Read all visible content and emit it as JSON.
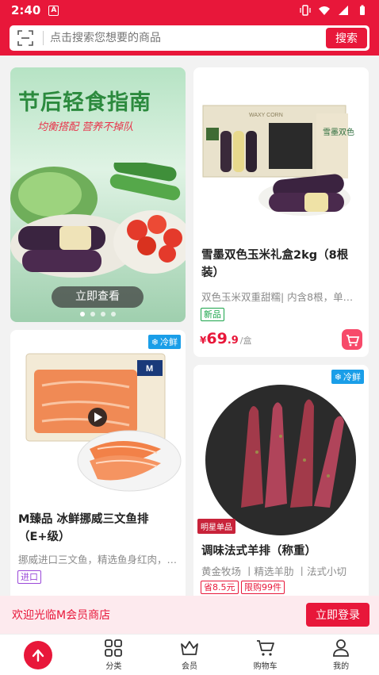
{
  "status": {
    "time": "2:40",
    "a_label": "A"
  },
  "search": {
    "placeholder": "点击搜索您想要的商品",
    "button": "搜索"
  },
  "banner": {
    "title": "节后轻食指南",
    "subtitle": "均衡搭配 营养不掉队",
    "button": "立即查看",
    "dots": 4,
    "active_dot": 0
  },
  "products": [
    {
      "name": "雪墨双色玉米礼盒2kg（8根装）",
      "desc": "双色玉米双重甜糯| 内含8根，单根…",
      "tag": "新品",
      "price_currency": "¥",
      "price_int": "69",
      "price_dec": ".9",
      "price_unit": "/盒",
      "box_text": "WAXY CORN",
      "box_side": "雪墨双色"
    },
    {
      "badge": "冷鲜",
      "name": "M臻品 冰鲜挪威三文鱼排（E+级）",
      "desc": "挪威进口三文鱼，精选鱼身红肉，…",
      "tag": "进口",
      "pack_logo": "M"
    },
    {
      "badge": "冷鲜",
      "store_tag": "明星单品",
      "name": "调味法式羊排（称重）",
      "desc": "黄金牧场 丨精选羊肋 丨法式小切",
      "tag1": "省8.5元",
      "tag2": "限购99件"
    }
  ],
  "promo": {
    "text": "欢迎光临M会员商店",
    "button": "立即登录"
  },
  "tabs": [
    {
      "label": ""
    },
    {
      "label": "分类"
    },
    {
      "label": "会员"
    },
    {
      "label": "购物车"
    },
    {
      "label": "我的"
    }
  ],
  "colors": {
    "brand": "#e8173a",
    "cold": "#1a9ee8"
  }
}
